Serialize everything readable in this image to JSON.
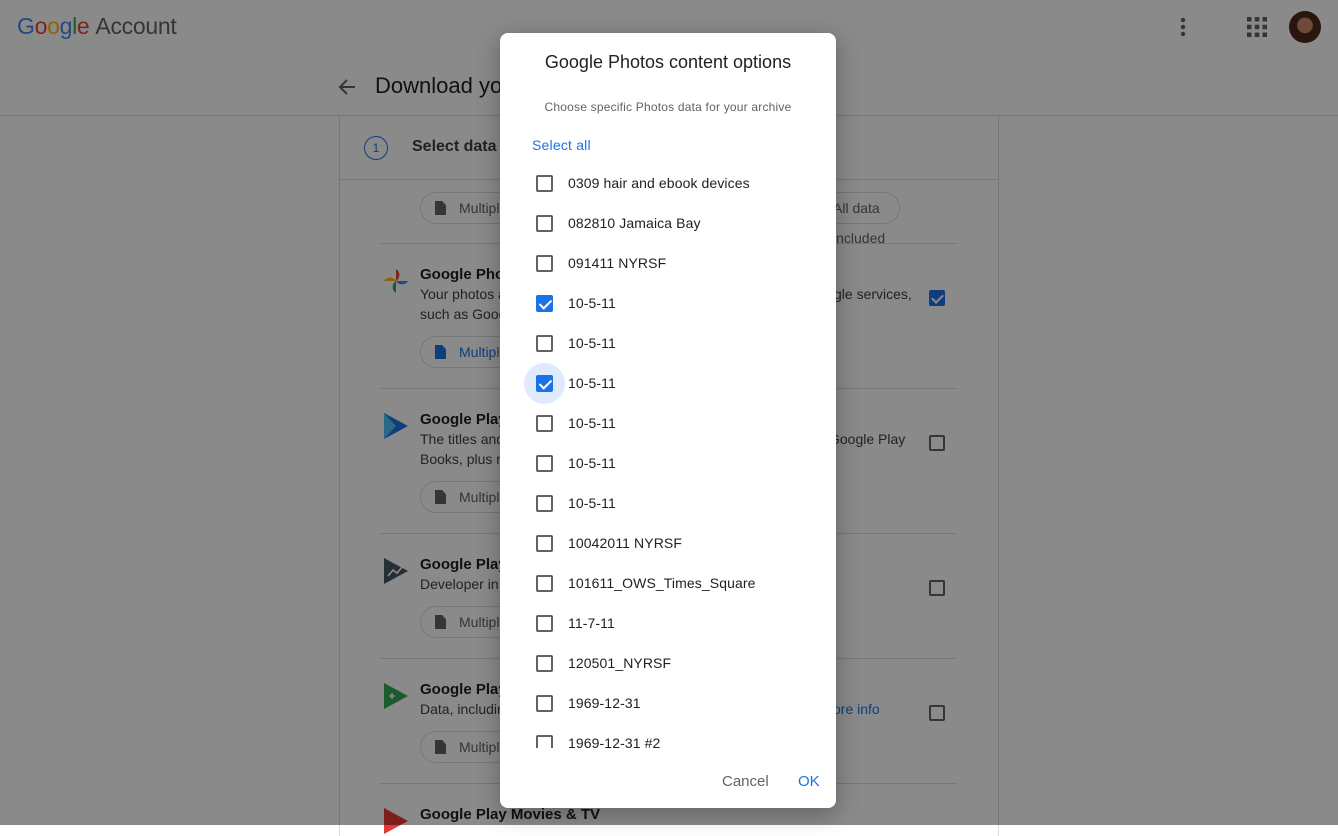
{
  "app": {
    "logo_google": [
      "G",
      "o",
      "o",
      "g",
      "l",
      "e"
    ],
    "logo_account": "Account"
  },
  "page": {
    "title": "Download your data"
  },
  "step": {
    "number": "1",
    "label": "Select data to include"
  },
  "chips": {
    "multiple_formats": "Multiple formats",
    "included": "All data included"
  },
  "products": [
    {
      "name": "Google Photos",
      "desc1": "Your photos and videos from Google Photos",
      "desc1_right": "gle services,",
      "desc2": "such as Google",
      "checked": true
    },
    {
      "name": "Google Play Books",
      "desc1": "The titles and",
      "desc1_right": "Google Play",
      "desc2": "Books, plus n",
      "checked": false
    },
    {
      "name": "Google Play Console",
      "desc1": "Developer in",
      "checked": false
    },
    {
      "name": "Google Play Games",
      "desc1": "Data, includin",
      "desc1_right": "ore info",
      "checked": false
    },
    {
      "name": "Google Play Movies & TV"
    }
  ],
  "dialog": {
    "title": "Google Photos content options",
    "subtitle": "Choose specific Photos data for your archive",
    "select_all": "Select all",
    "items": [
      {
        "label": "0309 hair and ebook devices",
        "checked": false
      },
      {
        "label": "082810 Jamaica Bay",
        "checked": false
      },
      {
        "label": "091411 NYRSF",
        "checked": false
      },
      {
        "label": "10-5-11",
        "checked": true
      },
      {
        "label": "10-5-11",
        "checked": false
      },
      {
        "label": "10-5-11",
        "checked": true,
        "focused": true
      },
      {
        "label": "10-5-11",
        "checked": false
      },
      {
        "label": "10-5-11",
        "checked": false
      },
      {
        "label": "10-5-11",
        "checked": false
      },
      {
        "label": "10042011 NYRSF",
        "checked": false
      },
      {
        "label": "101611_OWS_Times_Square",
        "checked": false
      },
      {
        "label": "11-7-11",
        "checked": false
      },
      {
        "label": "120501_NYRSF",
        "checked": false
      },
      {
        "label": "1969-12-31",
        "checked": false
      },
      {
        "label": "1969-12-31 #2",
        "checked": false
      }
    ],
    "cancel": "Cancel",
    "ok": "OK"
  },
  "colors": {
    "accent": "#1a73e8",
    "scrim": "rgba(0,0,0,0.46)"
  }
}
